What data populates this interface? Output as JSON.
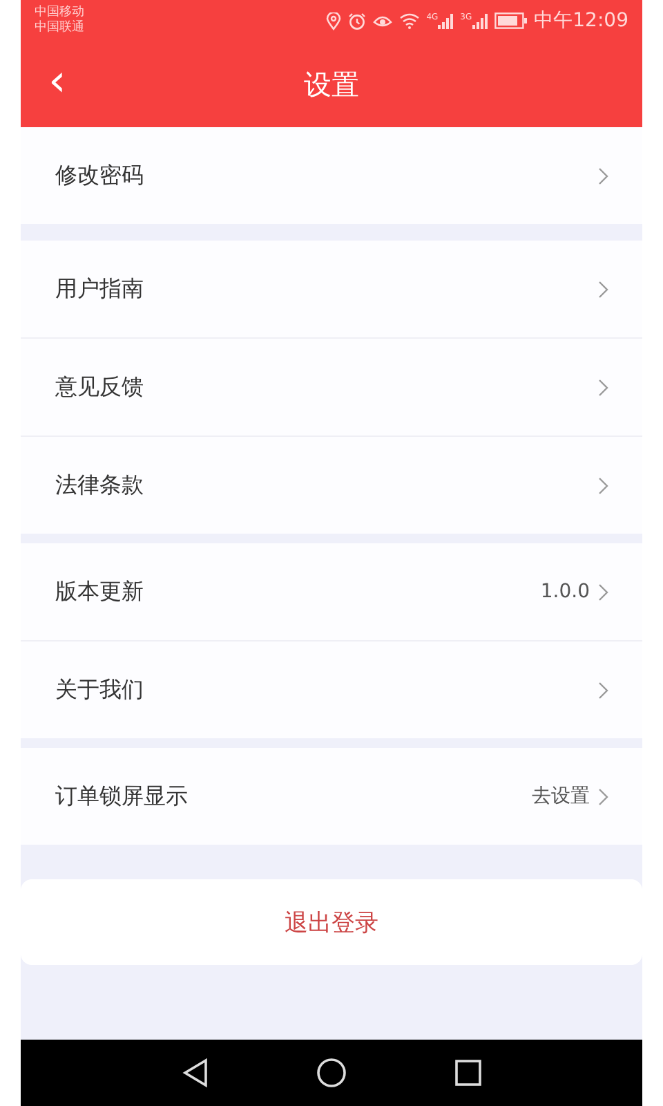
{
  "status_bar": {
    "carriers": [
      "中国移动",
      "中国联通"
    ],
    "networks": [
      "4G",
      "3G"
    ],
    "time": "中午12:09"
  },
  "header": {
    "back_icon": "‹",
    "title": "设置"
  },
  "groups": [
    {
      "items": [
        {
          "label": "修改密码"
        }
      ]
    },
    {
      "items": [
        {
          "label": "用户指南"
        },
        {
          "label": "意见反馈"
        },
        {
          "label": "法律条款"
        }
      ]
    },
    {
      "items": [
        {
          "label": "版本更新",
          "value": "1.0.0"
        },
        {
          "label": "关于我们"
        }
      ]
    },
    {
      "items": [
        {
          "label": "订单锁屏显示",
          "value": "去设置"
        }
      ]
    }
  ],
  "logout_button": "退出登录"
}
